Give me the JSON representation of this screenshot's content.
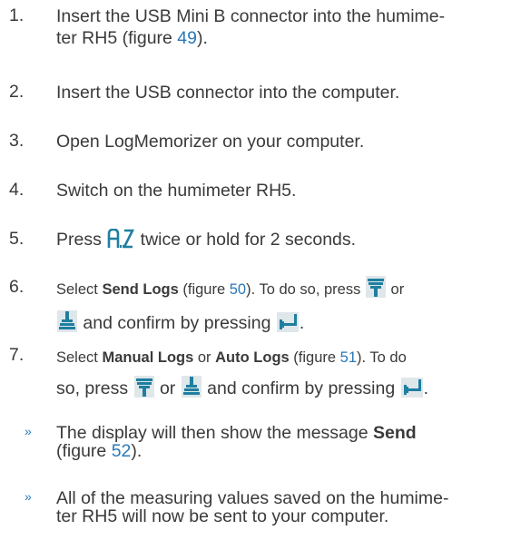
{
  "steps": [
    {
      "number": "1.",
      "text_a": "Insert the USB Mini B connector into the humime-",
      "text_b": "ter RH5 (figure ",
      "fig": "49",
      "text_c": ")."
    },
    {
      "number": "2.",
      "text": "Insert the USB connector into the computer."
    },
    {
      "number": "3.",
      "text": "Open LogMemorizer on your computer."
    },
    {
      "number": "4.",
      "text": "Switch on the humimeter RH5."
    },
    {
      "number": "5.",
      "text_a": "Press ",
      "text_b": " twice or hold for 2 seconds."
    },
    {
      "number": "6.",
      "text_a": "Select ",
      "bold": "Send Logs",
      "text_b": " (figure ",
      "fig": "50",
      "text_c": "). To do so, press ",
      "text_d": " or",
      "text_e": " and confirm by pressing ",
      "text_f": "."
    },
    {
      "number": "7.",
      "text_a": "Select ",
      "bold_a": "Manual Logs",
      "text_b": " or ",
      "bold_b": "Auto Logs",
      "text_c": " (figure ",
      "fig": "51",
      "text_d": "). To do",
      "text_e": "so, press ",
      "text_f": " or ",
      "text_g": " and confirm by pressing ",
      "text_h": "."
    }
  ],
  "results": [
    {
      "mark": "»",
      "text_a": "The display will then show the message ",
      "bold": "Send",
      "text_b": "(figure ",
      "fig": "52",
      "text_c": ")."
    },
    {
      "mark": "»",
      "text_a": "All of the measuring values saved on the humime-",
      "text_b": "ter RH5 will now be sent to your computer."
    }
  ],
  "icons": {
    "select_key": "select-a-z-key-icon",
    "down_key": "down-arrow-key-icon",
    "up_key": "up-arrow-key-icon",
    "enter_key": "enter-key-icon"
  },
  "colors": {
    "text": "#3a3a3a",
    "link": "#2a78b8",
    "icon": "#1f7fa0"
  }
}
